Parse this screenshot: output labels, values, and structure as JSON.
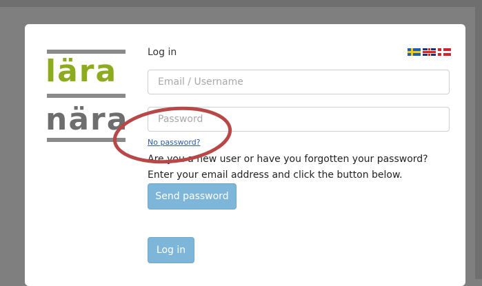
{
  "logo": {
    "word1": "lära",
    "word2": "nära"
  },
  "form": {
    "title": "Log in",
    "email_placeholder": "Email / Username",
    "password_placeholder": "Password",
    "no_password_link": "No password?",
    "help_line1": "Are you a new user or have you forgotten your password?",
    "help_line2": "Enter your email address and click the button below.",
    "send_password_label": "Send password",
    "login_label": "Log in"
  },
  "languages": [
    "sv",
    "en",
    "da"
  ],
  "colors": {
    "background": "#7f7f7f",
    "logo_green": "#8cab1f",
    "logo_gray": "#6e6e6e",
    "button": "#7eb6d9",
    "annotation": "#b84848"
  }
}
